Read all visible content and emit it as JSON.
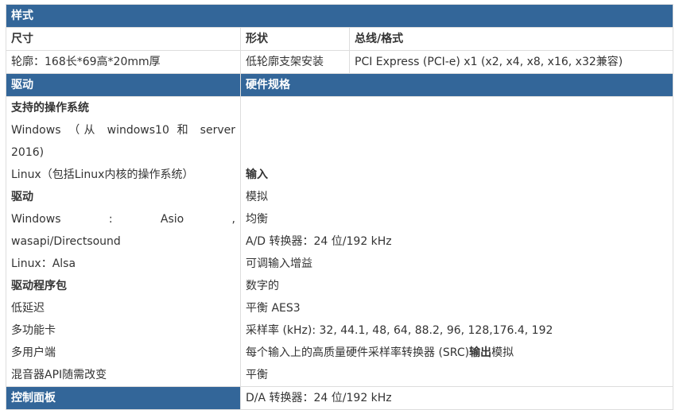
{
  "section_style": "样式",
  "size": {
    "label": "尺寸",
    "value": "轮廓：168长*69高*20mm厚"
  },
  "shape": {
    "label": "形状",
    "value": "低轮廓支架安装"
  },
  "bus": {
    "label": "总线/格式",
    "value": "PCI Express (PCI-e) x1 (x2, x4, x8, x16, x32兼容)"
  },
  "section_driver": "驱动",
  "section_hardware": "硬件规格",
  "left_lines": [
    {
      "text": "支持的操作系统",
      "bold": true
    },
    {
      "text": "Windows （从 windows10 和 server",
      "bold": false
    },
    {
      "text": "2016)",
      "bold": false
    },
    {
      "text": "Linux（包括Linux内核的操作系统）",
      "bold": false
    },
    {
      "text": "驱动",
      "bold": true
    },
    {
      "text": "Windows : Asio ,",
      "bold": false
    },
    {
      "text": "wasapi/Directsound",
      "bold": false
    },
    {
      "text": "Linux：Alsa",
      "bold": false
    },
    {
      "text": "驱动程序包",
      "bold": true
    },
    {
      "text": "低延迟",
      "bold": false
    },
    {
      "text": "多功能卡",
      "bold": false
    },
    {
      "text": "多用户端",
      "bold": false
    },
    {
      "text": "混音器API随需改变",
      "bold": false
    }
  ],
  "right_lines": [
    {
      "text": "",
      "bold": false
    },
    {
      "text": "",
      "bold": false
    },
    {
      "text": "",
      "bold": false
    },
    {
      "text": "输入",
      "bold": true
    },
    {
      "text": "模拟",
      "bold": false
    },
    {
      "text": "均衡",
      "bold": false
    },
    {
      "text": "A/D 转换器：24 位/192 kHz",
      "bold": false
    },
    {
      "text": "可调输入增益",
      "bold": false
    },
    {
      "text": "数字的",
      "bold": false
    },
    {
      "text": "平衡 AES3",
      "bold": false
    },
    {
      "text": "采样率 (kHz): 32, 44.1, 48, 64, 88.2, 96, 128,176.4, 192",
      "bold": false
    },
    {
      "text_a": "每个输入上的高质量硬件采样率转换器 (SRC)",
      "text_b": "输出",
      "text_c": "模拟"
    },
    {
      "text": "平衡",
      "bold": false
    }
  ],
  "section_control": "控制面板",
  "last_right": "D/A 转换器：24 位/192 kHz"
}
